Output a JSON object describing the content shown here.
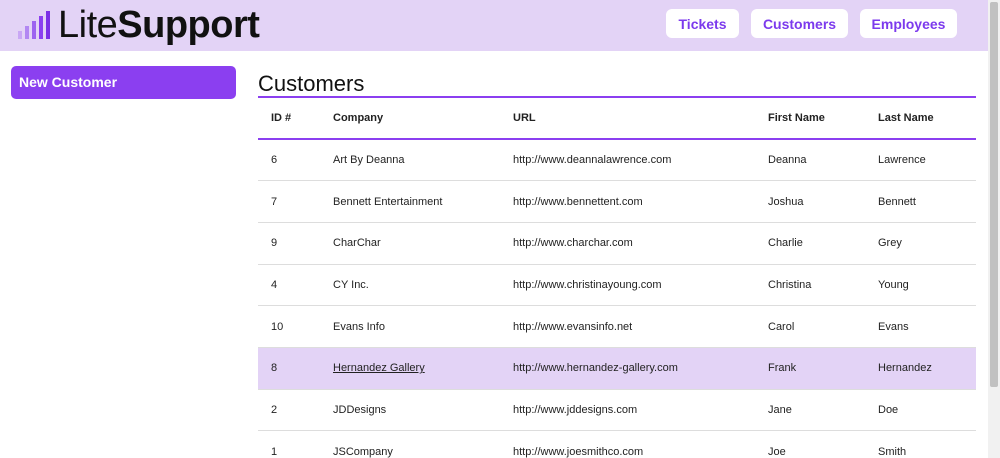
{
  "brand": {
    "part1": "Lite",
    "part2": "Support",
    "color": "#8b3ff0"
  },
  "nav": {
    "tickets": "Tickets",
    "customers": "Customers",
    "employees": "Employees"
  },
  "sidebar": {
    "new_customer": "New Customer"
  },
  "main": {
    "title": "Customers",
    "columns": [
      "ID #",
      "Company",
      "URL",
      "First Name",
      "Last Name"
    ],
    "rows": [
      {
        "id": "6",
        "company": "Art By Deanna",
        "url": "http://www.deannalawrence.com",
        "first": "Deanna",
        "last": "Lawrence"
      },
      {
        "id": "7",
        "company": "Bennett Entertainment",
        "url": "http://www.bennettent.com",
        "first": "Joshua",
        "last": "Bennett"
      },
      {
        "id": "9",
        "company": "CharChar",
        "url": "http://www.charchar.com",
        "first": "Charlie",
        "last": "Grey"
      },
      {
        "id": "4",
        "company": "CY Inc.",
        "url": "http://www.christinayoung.com",
        "first": "Christina",
        "last": "Young"
      },
      {
        "id": "10",
        "company": "Evans Info",
        "url": "http://www.evansinfo.net",
        "first": "Carol",
        "last": "Evans"
      },
      {
        "id": "8",
        "company": "Hernandez Gallery",
        "url": "http://www.hernandez-gallery.com",
        "first": "Frank",
        "last": "Hernandez"
      },
      {
        "id": "2",
        "company": "JDDesigns",
        "url": "http://www.jddesigns.com",
        "first": "Jane",
        "last": "Doe"
      },
      {
        "id": "1",
        "company": "JSCompany",
        "url": "http://www.joesmithco.com",
        "first": "Joe",
        "last": "Smith"
      }
    ]
  },
  "colors": {
    "accent": "#8b3ff0",
    "header_bg": "#e3d3f6",
    "row_highlight": "#e3d3f6"
  }
}
